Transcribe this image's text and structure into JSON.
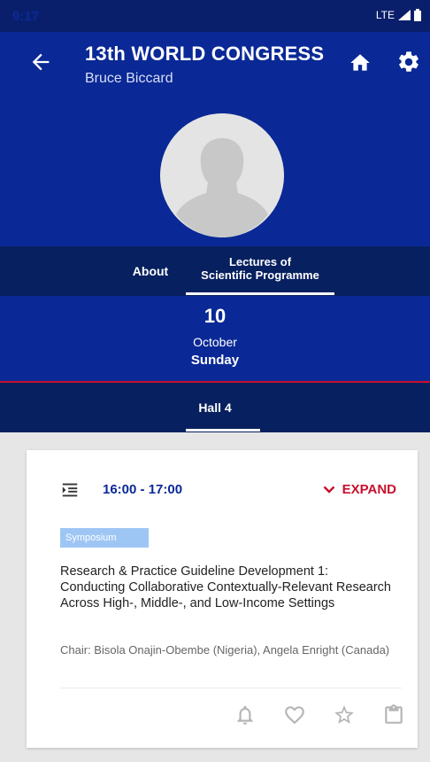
{
  "status": {
    "time": "9:17",
    "network": "LTE"
  },
  "header": {
    "title": "13th WORLD CONGRESS",
    "subtitle": "Bruce Biccard"
  },
  "tabs": [
    {
      "label": "About"
    },
    {
      "label": "Lectures of\nScientific Programme",
      "selected": true
    }
  ],
  "date": {
    "day": "10",
    "month": "October",
    "weekday": "Sunday"
  },
  "hall": {
    "label": "Hall 4"
  },
  "session": {
    "time": "16:00 - 17:00",
    "expand_label": "EXPAND",
    "badge": "Symposium",
    "title": "Research & Practice Guideline Development 1: Conducting Collaborative Contextually-Relevant Research Across High-, Middle-, and Low-Income Settings",
    "chair": "Chair: Bisola Onajin-Obembe (Nigeria), Angela Enright (Canada)"
  },
  "colors": {
    "primary": "#0a2996",
    "primary_dark": "#07205f",
    "accent": "#c8102e",
    "badge": "#9ec6f5"
  },
  "icons": [
    "back-arrow-icon",
    "home-icon",
    "gear-icon",
    "agenda-icon",
    "chevron-down-icon",
    "bell-icon",
    "heart-icon",
    "star-icon",
    "clipboard-icon"
  ]
}
